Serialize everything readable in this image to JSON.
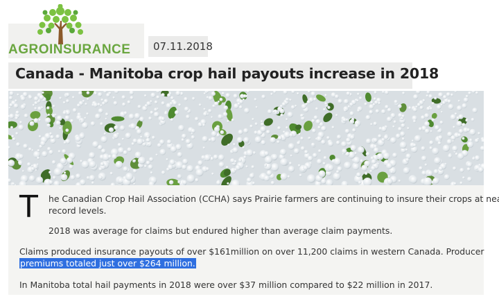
{
  "logo": {
    "text": "AGROINSURANCE",
    "tree_trunk_color": "#8c5a2b",
    "leaf_colors": [
      "#7cc242",
      "#5aa83a",
      "#9bd15a"
    ]
  },
  "article": {
    "date": "07.11.2018",
    "title": "Canada - Manitoba crop hail payouts increase in 2018",
    "dropcap": "T",
    "para1_line1": "he Canadian Crop Hail Association (CCHA) says Prairie farmers are continuing to insure their crops at near",
    "para1_line2": "record levels.",
    "para2": "2018 was average for claims but endured higher than average claim payments.",
    "para3_line1": "Claims produced insurance payouts of over $161million on over 11,200 claims in western Canada. Producer",
    "para3_line2_highlighted": "premiums totaled just over $264 million.",
    "para4": "In Manitoba total hail payments in 2018 were over $37 million compared to $22 million in 2017.",
    "highlight_color": "#2f6fe0"
  },
  "hero_image": {
    "subject": "hailstones-on-crops",
    "colors": [
      "#e8ecef",
      "#5f8f3a",
      "#3f6d28"
    ]
  }
}
